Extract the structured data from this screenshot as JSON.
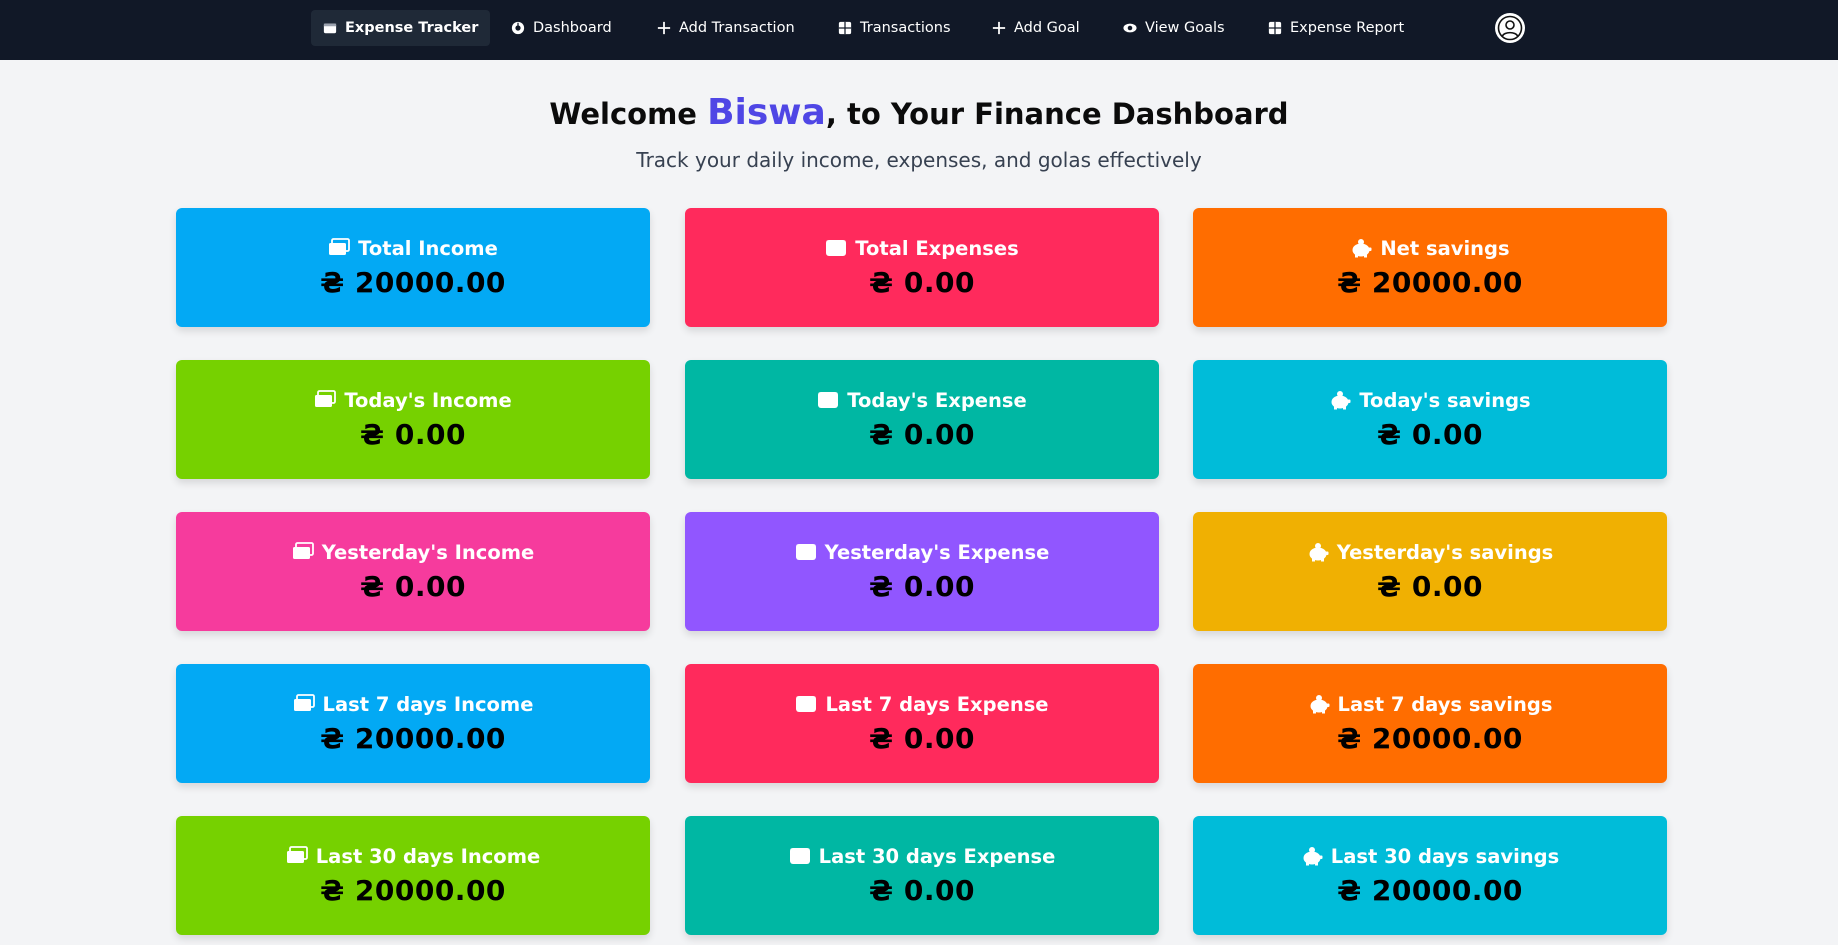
{
  "nav": {
    "brand": "Expense Tracker",
    "items": [
      {
        "label": "Dashboard",
        "icon": "dashboard-icon"
      },
      {
        "label": "Add Transaction",
        "icon": "plus-icon"
      },
      {
        "label": "Transactions",
        "icon": "table-icon"
      },
      {
        "label": "Add Goal",
        "icon": "plus-icon"
      },
      {
        "label": "View Goals",
        "icon": "eye-icon"
      },
      {
        "label": "Expense Report",
        "icon": "table-icon"
      }
    ]
  },
  "header": {
    "welcome": "Welcome ",
    "name": "Biswa",
    "rest": ", to Your Finance Dashboard",
    "subtitle": "Track your daily income, expenses, and golas effectively"
  },
  "cards": [
    {
      "label": "Total Income",
      "value": "₴ 20000.00",
      "icon": "money-icon",
      "color": "#03a9f4"
    },
    {
      "label": "Total Expenses",
      "value": "₴ 0.00",
      "icon": "wallet-icon",
      "color": "#ff2a5c"
    },
    {
      "label": "Net savings",
      "value": "₴ 20000.00",
      "icon": "piggy-bank-icon",
      "color": "#ff6d00"
    },
    {
      "label": "Today's Income",
      "value": "₴ 0.00",
      "icon": "money-icon",
      "color": "#76d100"
    },
    {
      "label": "Today's Expense",
      "value": "₴ 0.00",
      "icon": "wallet-icon",
      "color": "#00b7a3"
    },
    {
      "label": "Today's savings",
      "value": "₴ 0.00",
      "icon": "piggy-bank-icon",
      "color": "#00bcd9"
    },
    {
      "label": "Yesterday's Income",
      "value": "₴ 0.00",
      "icon": "money-icon",
      "color": "#f63b9d"
    },
    {
      "label": "Yesterday's Expense",
      "value": "₴ 0.00",
      "icon": "wallet-icon",
      "color": "#9156ff"
    },
    {
      "label": "Yesterday's savings",
      "value": "₴ 0.00",
      "icon": "piggy-bank-icon",
      "color": "#f0b002"
    },
    {
      "label": "Last 7 days Income",
      "value": "₴ 20000.00",
      "icon": "money-icon",
      "color": "#03a9f4"
    },
    {
      "label": "Last 7 days Expense",
      "value": "₴ 0.00",
      "icon": "wallet-icon",
      "color": "#ff2a5c"
    },
    {
      "label": "Last 7 days savings",
      "value": "₴ 20000.00",
      "icon": "piggy-bank-icon",
      "color": "#ff6d00"
    },
    {
      "label": "Last 30 days Income",
      "value": "₴ 20000.00",
      "icon": "money-icon",
      "color": "#76d100"
    },
    {
      "label": "Last 30 days Expense",
      "value": "₴ 0.00",
      "icon": "wallet-icon",
      "color": "#00b7a3"
    },
    {
      "label": "Last 30 days savings",
      "value": "₴ 20000.00",
      "icon": "piggy-bank-icon",
      "color": "#00bcd9"
    }
  ]
}
